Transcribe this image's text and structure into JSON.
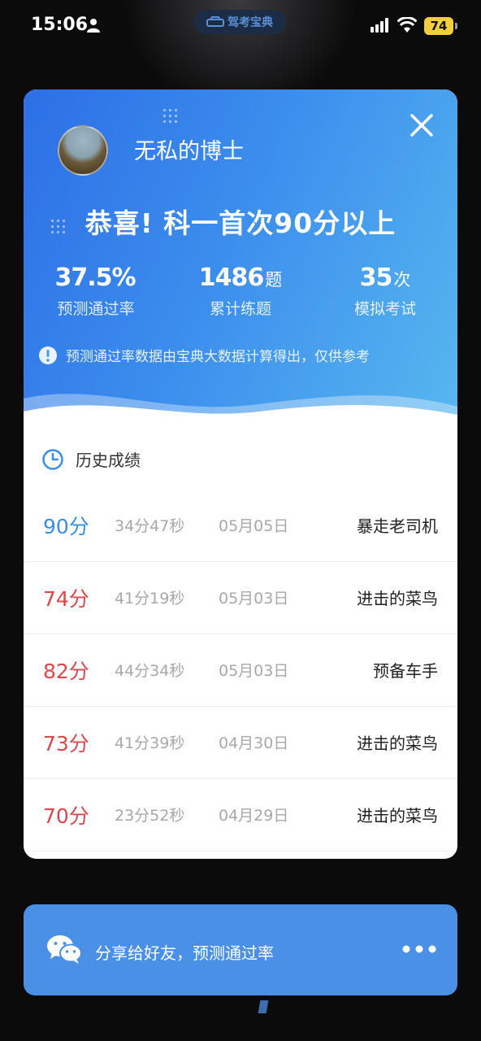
{
  "status_bar": {
    "time": "15:06",
    "app_name": "驾考宝典",
    "battery": "74"
  },
  "card": {
    "username": "无私的博士",
    "congrats": "恭喜! 科一首次90分以上",
    "stats": [
      {
        "value": "37.5%",
        "unit": "",
        "label": "预测通过率"
      },
      {
        "value": "1486",
        "unit": "题",
        "label": "累计练题"
      },
      {
        "value": "35",
        "unit": "次",
        "label": "模拟考试"
      }
    ],
    "notice": "预测通过率数据由宝典大数据计算得出，仅供参考",
    "history_title": "历史成绩",
    "history": [
      {
        "score": "90分",
        "duration": "34分47秒",
        "date": "05月05日",
        "title": "暴走老司机",
        "color": "#3a8ee8"
      },
      {
        "score": "74分",
        "duration": "41分19秒",
        "date": "05月03日",
        "title": "进击的菜鸟",
        "color": "#d9484a"
      },
      {
        "score": "82分",
        "duration": "44分34秒",
        "date": "05月03日",
        "title": "预备车手",
        "color": "#d9484a"
      },
      {
        "score": "73分",
        "duration": "41分39秒",
        "date": "04月30日",
        "title": "进击的菜鸟",
        "color": "#d9484a"
      },
      {
        "score": "70分",
        "duration": "23分52秒",
        "date": "04月29日",
        "title": "进击的菜鸟",
        "color": "#d9484a"
      }
    ]
  },
  "share": {
    "label": "分享给好友，预测通过率"
  },
  "icons": {
    "close": "close-icon",
    "clock": "clock-icon",
    "info": "info-icon",
    "wechat": "wechat-icon",
    "more": "more-icon"
  },
  "colors": {
    "hero_start": "#2d6fe6",
    "hero_end": "#58b7ef",
    "pass_score": "#3a8ee8",
    "fail_score": "#d9484a",
    "share_bar": "#4a90e6"
  }
}
